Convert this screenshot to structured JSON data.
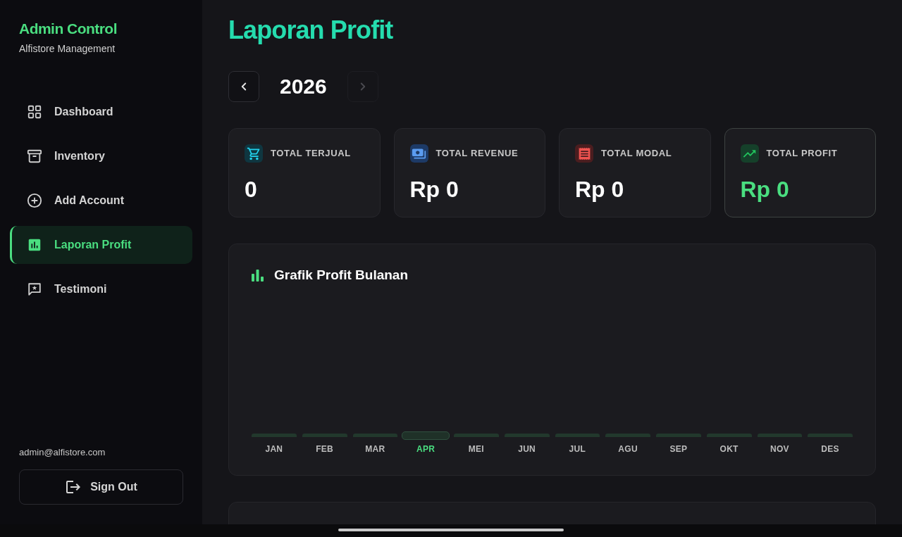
{
  "sidebar": {
    "brand": {
      "title": "Admin Control",
      "subtitle": "Alfistore Management"
    },
    "nav": [
      {
        "label": "Dashboard",
        "selected": false
      },
      {
        "label": "Inventory",
        "selected": false
      },
      {
        "label": "Add Account",
        "selected": false
      },
      {
        "label": "Laporan Profit",
        "selected": true
      },
      {
        "label": "Testimoni",
        "selected": false
      }
    ],
    "user_email": "admin@alfistore.com",
    "sign_out": "Sign Out"
  },
  "page": {
    "title": "Laporan Profit",
    "year_nav": {
      "prev": {
        "disabled": false
      },
      "year": "2026",
      "next": {
        "disabled": true
      }
    },
    "stats": [
      {
        "label": "TOTAL TERJUAL",
        "value": "0",
        "highlighted": false
      },
      {
        "label": "TOTAL REVENUE",
        "value": "Rp 0",
        "highlighted": false
      },
      {
        "label": "TOTAL MODAL",
        "value": "Rp 0",
        "highlighted": false
      },
      {
        "label": "TOTAL PROFIT",
        "value": "Rp 0",
        "highlighted": true
      }
    ],
    "chart": {
      "title": "Grafik Profit Bulanan",
      "months": [
        {
          "label": "JAN",
          "selected": false
        },
        {
          "label": "FEB",
          "selected": false
        },
        {
          "label": "MAR",
          "selected": false
        },
        {
          "label": "APR",
          "selected": true
        },
        {
          "label": "MEI",
          "selected": false
        },
        {
          "label": "JUN",
          "selected": false
        },
        {
          "label": "JUL",
          "selected": false
        },
        {
          "label": "AGU",
          "selected": false
        },
        {
          "label": "SEP",
          "selected": false
        },
        {
          "label": "OKT",
          "selected": false
        },
        {
          "label": "NOV",
          "selected": false
        },
        {
          "label": "DES",
          "selected": false
        }
      ]
    }
  }
}
